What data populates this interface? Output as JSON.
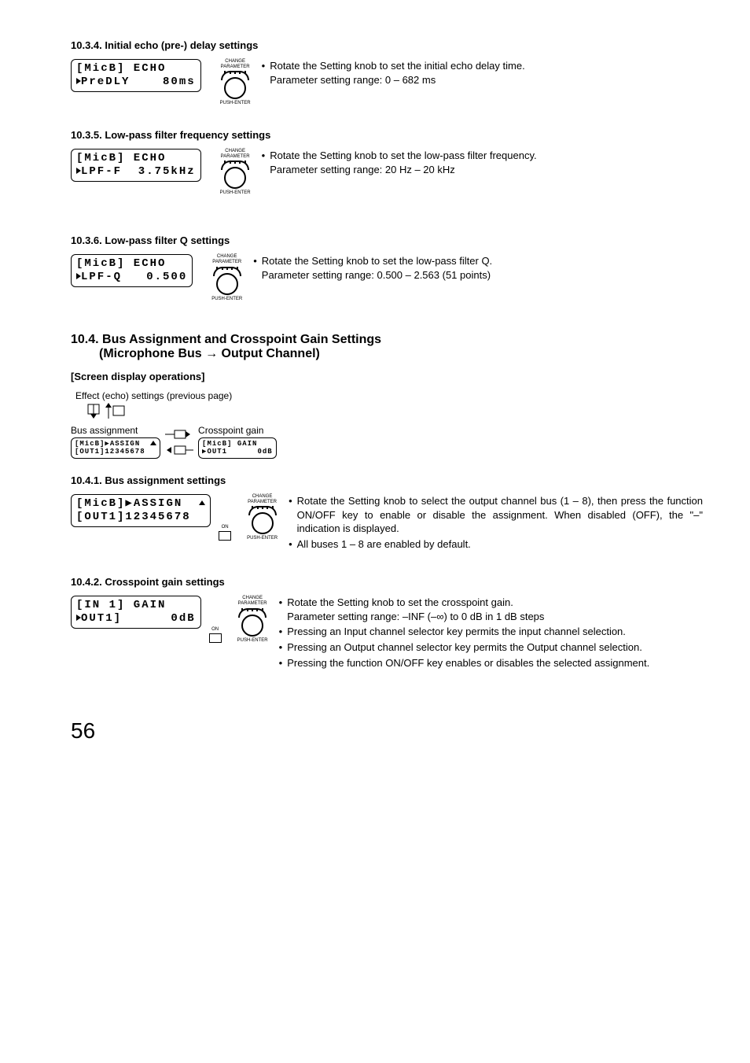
{
  "page_number": "56",
  "knob": {
    "top_label_1": "CHANGE",
    "top_label_2": "PARAMETER",
    "bottom_label": "PUSH-ENTER"
  },
  "on_label": "ON",
  "sections": {
    "s1034": {
      "title": "10.3.4. Initial echo (pre-) delay settings",
      "lcd_line1": "[MicB] ECHO",
      "lcd_line2": "PreDLY    80ms",
      "bullet1": "Rotate the Setting knob to set the initial echo delay time.",
      "line2": "Parameter setting range: 0 – 682 ms"
    },
    "s1035": {
      "title": "10.3.5. Low-pass filter frequency settings",
      "lcd_line1": "[MicB] ECHO",
      "lcd_line2": "LPF-F  3.75kHz",
      "bullet1": "Rotate the Setting knob to set the low-pass filter frequency.",
      "line2": "Parameter setting range: 20 Hz – 20 kHz"
    },
    "s1036": {
      "title": "10.3.6. Low-pass filter Q settings",
      "lcd_line1": "[MicB] ECHO",
      "lcd_line2": "LPF-Q   0.500",
      "bullet1": "Rotate the Setting knob to set the low-pass filter Q.",
      "line2": "Parameter setting range: 0.500 – 2.563 (51 points)"
    },
    "s104": {
      "title_line1": "10.4. Bus Assignment and Crosspoint Gain Settings",
      "title_line2": "(Microphone Bus → Output Channel)",
      "screen_ops": "[Screen display operations]",
      "prev_page": "Effect (echo) settings (previous page)",
      "bus_assignment": "Bus assignment",
      "crosspoint_gain": "Crosspoint gain",
      "lcd_assign_1": "[MicB]▶ASSIGN",
      "lcd_assign_2": "[OUT1]12345678",
      "lcd_gain_1": "[MicB] GAIN",
      "lcd_gain_2": "▶OUT1      0dB"
    },
    "s1041": {
      "title": "10.4.1. Bus assignment settings",
      "lcd_line1": "[MicB]▶ASSIGN",
      "lcd_line2": "[OUT1]12345678",
      "bullet1": "Rotate the Setting knob to select the output channel bus (1 – 8), then press the function ON/OFF key to enable or disable the assignment. When disabled (OFF), the \"–\" indication is displayed.",
      "bullet2": "All buses 1 – 8 are enabled by default."
    },
    "s1042": {
      "title": "10.4.2. Crosspoint gain settings",
      "lcd_line1": "[IN 1] GAIN",
      "lcd_line2": "OUT1]      0dB",
      "bullet1": "Rotate the Setting knob to set the crosspoint gain.",
      "line2": "Parameter setting range: –INF (–∞) to 0 dB in 1 dB steps",
      "bullet2": "Pressing an Input channel selector key permits the input channel selection.",
      "bullet3": "Pressing an Output channel selector key permits the Output channel selection.",
      "bullet4": "Pressing the function ON/OFF key enables or disables the selected assignment."
    }
  }
}
